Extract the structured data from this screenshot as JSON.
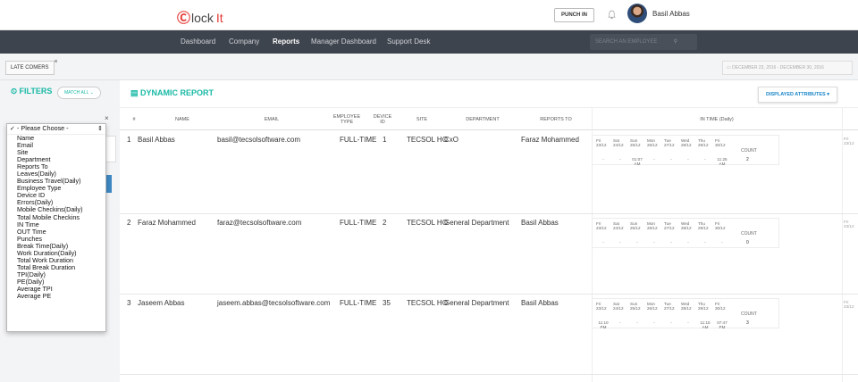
{
  "header": {
    "logo_left": "lock",
    "logo_right": "It",
    "punch_label": "PUNCH IN",
    "user_name": "Basil Abbas"
  },
  "nav": {
    "items": [
      "Dashboard",
      "Company",
      "Reports",
      "Manager Dashboard",
      "Support Desk"
    ],
    "active": "Reports",
    "search_placeholder": "SEARCH AN EMPLOYEE"
  },
  "subbar": {
    "chip_label": "LATE COMERS",
    "date_range": "DECEMBER 23, 2016 - DECEMBER 30, 2016"
  },
  "filters": {
    "title": "FILTERS",
    "match_label": "MATCH ALL",
    "dropdown_selected": "- Please Choose -",
    "dropdown_options": [
      "Name",
      "Email",
      "Site",
      "Department",
      "Reports To",
      "Leaves(Daily)",
      "Business Travel(Daily)",
      "Employee Type",
      "Device ID",
      "Errors(Daily)",
      "Mobile Checkins(Daily)",
      "Total Mobile Checkins",
      "IN Time",
      "OUT Time",
      "Punches",
      "Break Time(Daily)",
      "Work Duration(Daily)",
      "Total Work Duration",
      "Total Break Duration",
      "TPI(Daily)",
      "PE(Daily)",
      "Average TPI",
      "Average PE"
    ]
  },
  "report": {
    "title": "DYNAMIC REPORT",
    "displayed_attributes": "DISPLAYED ATTRIBUTES",
    "columns": [
      "#",
      "NAME",
      "EMAIL",
      "EMPLOYEE TYPE",
      "DEVICE ID",
      "SITE",
      "DEPARTMENT",
      "REPORTS TO",
      "IN TIME (Daily)"
    ],
    "count_label": "COUNT",
    "rows": [
      {
        "num": "1",
        "name": "Basil Abbas",
        "email": "basil@tecsolsoftware.com",
        "type": "FULL-TIME",
        "device": "1",
        "site": "TECSOL HO",
        "dept": "CxO",
        "reports_to": "Faraz Mohammed",
        "days": [
          "Fri 23/12",
          "Sat 24/12",
          "Sun 25/12",
          "Mon 26/12",
          "Tue 27/12",
          "Wed 28/12",
          "Thu 29/12",
          "Fri 30/12"
        ],
        "times": [
          "-",
          "-",
          "01:07 AM",
          "-",
          "-",
          "-",
          "-",
          "11:25 AM"
        ],
        "count": "2"
      },
      {
        "num": "2",
        "name": "Faraz Mohammed",
        "email": "faraz@tecsolsoftware.com",
        "type": "FULL-TIME",
        "device": "2",
        "site": "TECSOL HO",
        "dept": "General Department",
        "reports_to": "Basil Abbas",
        "days": [
          "Fri 23/12",
          "Sat 24/12",
          "Sun 25/12",
          "Mon 26/12",
          "Tue 27/12",
          "Wed 28/12",
          "Thu 29/12",
          "Fri 30/12"
        ],
        "times": [
          "-",
          "-",
          "-",
          "-",
          "-",
          "-",
          "-",
          "-"
        ],
        "count": "0"
      },
      {
        "num": "3",
        "name": "Jaseem Abbas",
        "email": "jaseem.abbas@tecsolsoftware.com",
        "type": "FULL-TIME",
        "device": "35",
        "site": "TECSOL HO",
        "dept": "General Department",
        "reports_to": "Basil Abbas",
        "days": [
          "Fri 23/12",
          "Sat 24/12",
          "Sun 25/12",
          "Mon 26/12",
          "Tue 27/12",
          "Wed 28/12",
          "Thu 29/12",
          "Fri 30/12"
        ],
        "times": [
          "11:10 PM",
          "-",
          "-",
          "-",
          "-",
          "-",
          "11:15 AM",
          "07:47 PM"
        ],
        "count": "3"
      }
    ]
  }
}
